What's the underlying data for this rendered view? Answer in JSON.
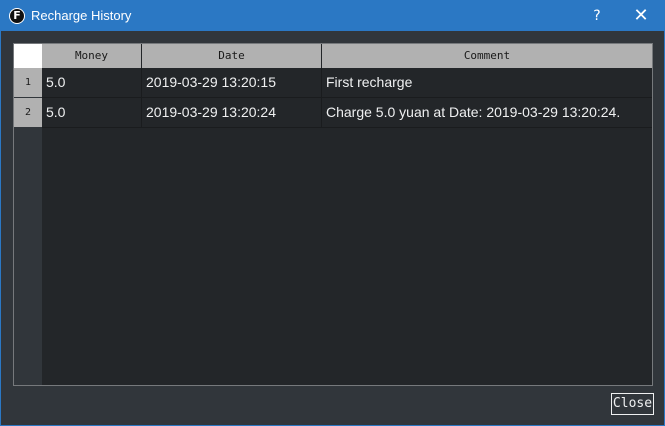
{
  "window": {
    "title": "Recharge History",
    "app_icon_letter": "F",
    "help_glyph": "?",
    "close_glyph": "✕"
  },
  "table": {
    "columns": [
      "Money",
      "Date",
      "Comment"
    ],
    "rows": [
      {
        "index": "1",
        "money": "5.0",
        "date": "2019-03-29 13:20:15",
        "comment": "First recharge"
      },
      {
        "index": "2",
        "money": "5.0",
        "date": "2019-03-29 13:20:24",
        "comment": "Charge 5.0 yuan at Date: 2019-03-29 13:20:24."
      }
    ]
  },
  "footer": {
    "close_label": "Close"
  },
  "colors": {
    "titlebar": "#2b78c4",
    "background": "#31363b",
    "table_background": "#232629",
    "header_background": "#b1b1b1",
    "text": "#eff0f1"
  }
}
